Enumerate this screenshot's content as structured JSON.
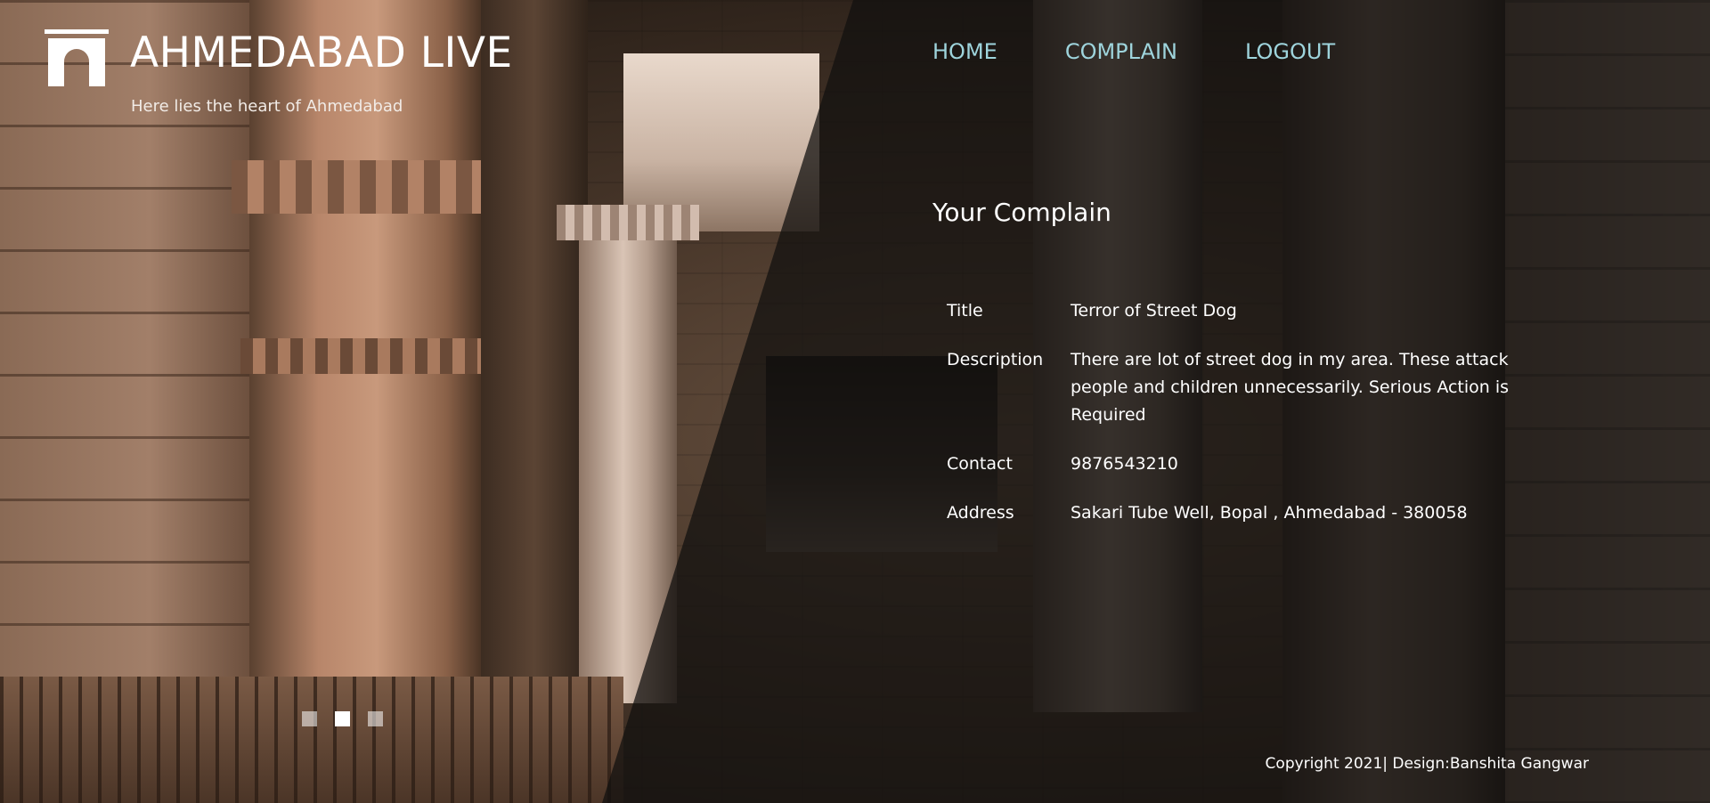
{
  "header": {
    "site_title": "AHMEDABAD LIVE",
    "tagline": "Here lies the heart of Ahmedabad",
    "logo_icon": "arch-gate-icon"
  },
  "nav": {
    "items": [
      {
        "label": "HOME"
      },
      {
        "label": "COMPLAIN"
      },
      {
        "label": "LOGOUT"
      }
    ],
    "link_color": "#9ed4dc"
  },
  "complaint": {
    "heading": "Your Complain",
    "fields": [
      {
        "label": "Title",
        "value": "Terror of Street Dog"
      },
      {
        "label": "Description",
        "value": "There are lot of street dog in my area. These attack people and children unnecessarily. Serious Action is Required"
      },
      {
        "label": "Contact",
        "value": "9876543210"
      },
      {
        "label": "Address",
        "value": "Sakari Tube Well, Bopal , Ahmedabad - 380058"
      }
    ]
  },
  "slider": {
    "slide_count": 3,
    "active_index": 1
  },
  "footer": {
    "text": "Copyright 2021| Design:Banshita Gangwar"
  }
}
